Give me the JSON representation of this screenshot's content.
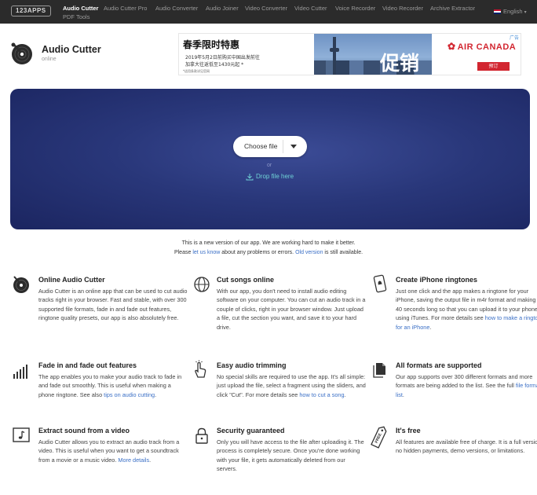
{
  "nav": {
    "brand": "123APPS",
    "items": [
      {
        "label": "Audio Cutter",
        "active": true
      },
      {
        "label": "Audio Cutter Pro"
      },
      {
        "label": "Audio Converter"
      },
      {
        "label": "Audio Joiner"
      },
      {
        "label": "Video Converter"
      },
      {
        "label": "Video Cutter"
      },
      {
        "label": "Voice Recorder"
      },
      {
        "label": "Video Recorder"
      },
      {
        "label": "Archive Extractor"
      },
      {
        "label": "PDF Tools"
      }
    ],
    "language": "English"
  },
  "header": {
    "title": "Audio Cutter",
    "subtitle": "online"
  },
  "ad": {
    "headline": "春季限时特惠",
    "line1": "2019年5月2日前购买中国出发前往",
    "line2": "加拿大往返低至1430元起 *",
    "footnote": "*适用条款详见官网",
    "big": "促销",
    "brand": "AIR CANADA",
    "button": "预订",
    "badge": "广告"
  },
  "upload": {
    "choose_label": "Choose file",
    "or": "or",
    "drop_label": "Drop file here"
  },
  "notice": {
    "line1": "This is a new version of our app. We are working hard to make it better.",
    "please": "Please ",
    "let_us_know": "let us know",
    "middle": " about any problems or errors. ",
    "old_version": "Old version",
    "end": " is still available."
  },
  "features": [
    {
      "icon": "record-icon",
      "title": "Online Audio Cutter",
      "text": "Audio Cutter is an online app that can be used to cut audio tracks right in your browser. Fast and stable, with over 300 supported file formats, fade in and fade out features, ringtone quality presets, our app is also absolutely free.",
      "link": ""
    },
    {
      "icon": "globe-icon",
      "title": "Cut songs online",
      "text": "With our app, you don't need to install audio editing software on your computer. You can cut an audio track in a couple of clicks, right in your browser window. Just upload a file, cut the section you want, and save it to your hard drive.",
      "link": ""
    },
    {
      "icon": "phone-bell-icon",
      "title": "Create iPhone ringtones",
      "text": "Just one click and the app makes a ringtone for your iPhone, saving the output file in m4r format and making it 40 seconds long so that you can upload it to your phone using iTunes. For more details see ",
      "link": "how to make a ringtone for an iPhone",
      "after": "."
    },
    {
      "icon": "fade-bars-icon",
      "title": "Fade in and fade out features",
      "text": "The app enables you to make your audio track to fade in and fade out smoothly. This is useful when making a phone ringtone. See also ",
      "link": "tips on audio cutting",
      "after": "."
    },
    {
      "icon": "hand-pointer-icon",
      "title": "Easy audio trimming",
      "text": "No special skills are required to use the app. It's all simple: just upload the file, select a fragment using the sliders, and click \"Cut\". For more details see ",
      "link": "how to cut a song",
      "after": "."
    },
    {
      "icon": "files-icon",
      "title": "All formats are supported",
      "text": "Our app supports over 300 different formats and more formats are being added to the list. See the full ",
      "link": "file format list",
      "after": "."
    },
    {
      "icon": "music-video-icon",
      "title": "Extract sound from a video",
      "text": "Audio Cutter allows you to extract an audio track from a video. This is useful when you want to get a soundtrack from a movie or a music video. ",
      "link": "More details",
      "after": "."
    },
    {
      "icon": "lock-icon",
      "title": "Security guaranteed",
      "text": "Only you will have access to the file after uploading it. The process is completely secure. Once you're done working with your file, it gets automatically deleted from our servers.",
      "link": ""
    },
    {
      "icon": "free-tag-icon",
      "title": "It's free",
      "text": "All features are available free of charge. It is a full version: no hidden payments, demo versions, or limitations.",
      "link": ""
    }
  ]
}
